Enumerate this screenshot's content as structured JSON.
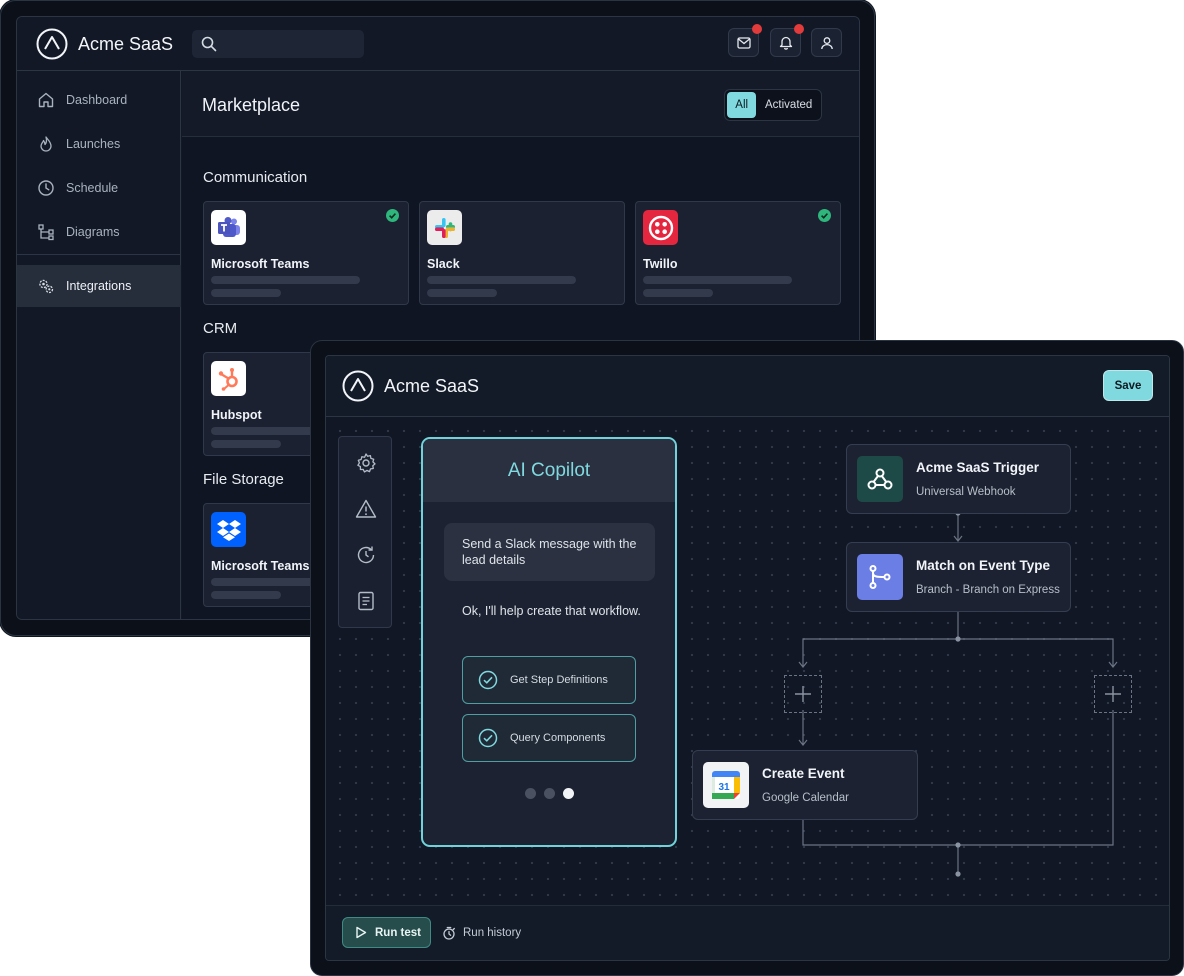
{
  "back_window": {
    "app_name": "Acme SaaS",
    "search": {
      "placeholder": ""
    },
    "sidebar": {
      "items": [
        {
          "label": "Dashboard",
          "icon": "home-icon"
        },
        {
          "label": "Launches",
          "icon": "flame-icon"
        },
        {
          "label": "Schedule",
          "icon": "clock-icon"
        },
        {
          "label": "Diagrams",
          "icon": "diagram-icon"
        },
        {
          "label": "Integrations",
          "icon": "gears-icon",
          "active": true
        }
      ]
    },
    "page_title": "Marketplace",
    "filter": {
      "all": "All",
      "activated": "Activated",
      "selected": "All"
    },
    "sections": [
      {
        "label": "Communication",
        "cards": [
          {
            "name": "Microsoft Teams",
            "activated": true
          },
          {
            "name": "Slack",
            "activated": false
          },
          {
            "name": "Twillo",
            "activated": true
          }
        ]
      },
      {
        "label": "CRM",
        "cards": [
          {
            "name": "Hubspot"
          }
        ]
      },
      {
        "label": "File Storage",
        "cards": [
          {
            "name": "Microsoft Teams"
          }
        ]
      }
    ]
  },
  "front_window": {
    "app_name": "Acme SaaS",
    "save_label": "Save",
    "copilot": {
      "title": "AI Copilot",
      "user_message": "Send a Slack message with the lead details",
      "reply": "Ok, I'll help create that workflow.",
      "steps": [
        "Get Step Definitions",
        "Query Components"
      ],
      "pager": {
        "total": 3,
        "current": 3
      }
    },
    "nodes": {
      "trigger": {
        "title": "Acme SaaS Trigger",
        "subtitle": "Universal Webhook"
      },
      "branch": {
        "title": "Match on Event Type",
        "subtitle": "Branch - Branch on Express"
      },
      "calendar": {
        "title": "Create Event",
        "subtitle": "Google Calendar",
        "icon_text": "31"
      }
    },
    "footer": {
      "run_test": "Run test",
      "run_history": "Run history"
    }
  },
  "colors": {
    "accent": "#7fd9de",
    "background": "#121826",
    "notification": "#e23b3b",
    "success": "#2fb67c"
  }
}
